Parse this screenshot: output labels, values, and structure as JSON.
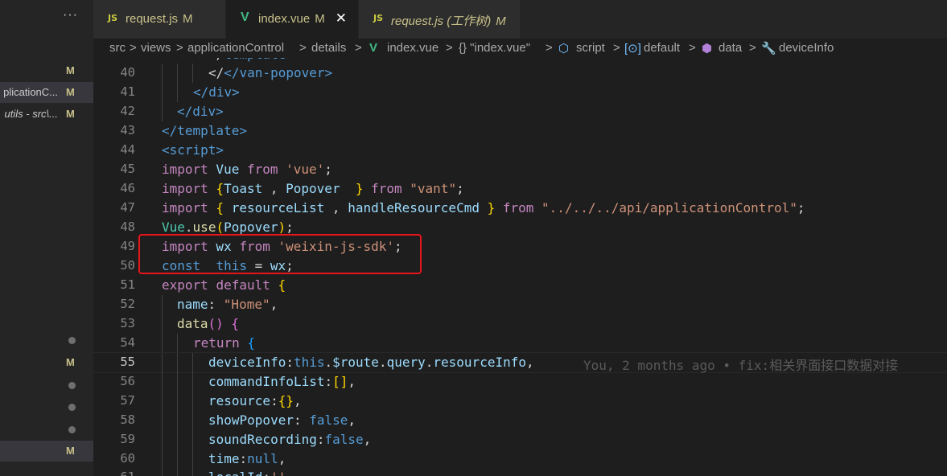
{
  "sidebar": {
    "more_label": "···",
    "items": [
      {
        "name": "",
        "badge": "M"
      },
      {
        "name": "plicationC...",
        "badge": "M"
      },
      {
        "name": "utils - src\\...",
        "badge": "M"
      },
      {
        "badge_dot": true
      },
      {
        "name": "",
        "badge": "M"
      },
      {
        "badge_dot": true
      },
      {
        "badge_dot": true
      },
      {
        "badge_dot": true
      },
      {
        "name": "",
        "badge": "M"
      }
    ]
  },
  "tabs": [
    {
      "icon": "JS",
      "label": "request.js",
      "badge": "M"
    },
    {
      "icon": "V",
      "label": "index.vue",
      "badge": "M",
      "close": "✕"
    },
    {
      "icon": "JS",
      "label": "request.js (工作树)",
      "badge": "M"
    }
  ],
  "breadcrumb": {
    "parts": [
      "src",
      "views",
      "applicationControl",
      "details",
      "index.vue",
      "{} \"index.vue\"",
      "script",
      "default",
      "data",
      "deviceInfo"
    ],
    "separator": ">"
  },
  "editor": {
    "line_numbers": [
      "40",
      "41",
      "42",
      "43",
      "44",
      "45",
      "46",
      "47",
      "48",
      "49",
      "50",
      "51",
      "52",
      "53",
      "54",
      "55",
      "56",
      "57",
      "58",
      "59",
      "60",
      "61"
    ],
    "current_line": "55",
    "blame": "You, 2 months ago • fix:相关界面接口数据对接",
    "code": {
      "l39": "</van-popover>",
      "l40": "</div>",
      "l41": "</div>",
      "l42": "</template>",
      "l43": "<script>",
      "l45": [
        "import",
        " Vue ",
        "from",
        " 'vue'",
        ";"
      ],
      "l46": [
        "import",
        " {",
        "Toast",
        " , ",
        "Popover",
        "  }",
        " from ",
        "\"vant\"",
        ";"
      ],
      "l47": [
        "import",
        " { ",
        "resourceList",
        " , ",
        "handleResourceCmd",
        " } ",
        "from",
        " \"../../../api/applicationControl\"",
        ";"
      ],
      "l48": [
        "Vue",
        ".",
        "use",
        "(",
        "Popover",
        ")",
        ";"
      ],
      "l49": [
        "import",
        " wx ",
        "from",
        " 'weixin-js-sdk'",
        ";"
      ],
      "l50": [
        "const",
        " _this",
        " = ",
        "wx",
        ";"
      ],
      "l51": [
        "export",
        " ",
        "default",
        " {"
      ],
      "l52": [
        "name",
        ": ",
        "\"Home\"",
        ","
      ],
      "l53": [
        "data",
        "()",
        " {"
      ],
      "l54": [
        "return",
        " {"
      ],
      "l55": [
        "deviceInfo",
        ":",
        "this",
        ".",
        "$route",
        ".",
        "query",
        ".",
        "resourceInfo",
        ","
      ],
      "l56": [
        "commandInfoList",
        ":",
        "[]",
        ","
      ],
      "l57": [
        "resource",
        ":",
        "{}",
        ","
      ],
      "l58": [
        "showPopover",
        ": ",
        "false",
        ","
      ],
      "l59": [
        "soundRecording",
        ":",
        "false",
        ","
      ],
      "l60": [
        "time",
        ":",
        "null",
        ","
      ],
      "l61": [
        "localId",
        ":",
        "''"
      ]
    }
  }
}
